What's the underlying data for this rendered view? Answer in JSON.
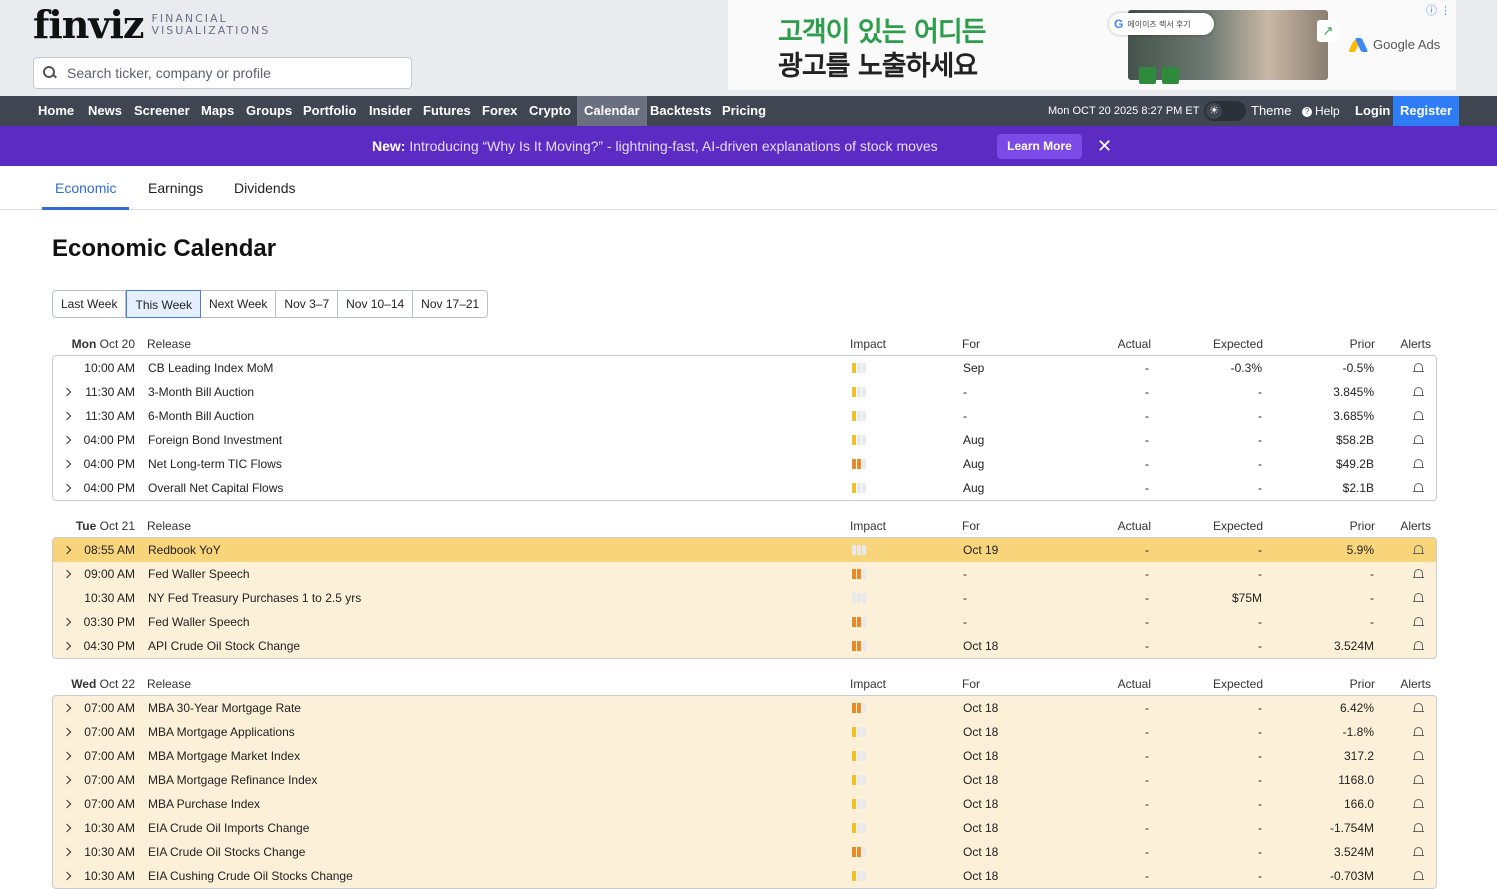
{
  "logo": {
    "word": "finviz",
    "sub1": "FINANCIAL",
    "sub2": "VISUALIZATIONS"
  },
  "search": {
    "placeholder": "Search ticker, company or profile"
  },
  "ad": {
    "line1": "고객이 있는 어디든",
    "line2": "광고를 노출하세요",
    "searchbar_text": "에이이즈 렉서 후기",
    "brand": "Google Ads",
    "info_icon": "info-icon"
  },
  "nav": {
    "items": [
      "Home",
      "News",
      "Screener",
      "Maps",
      "Groups",
      "Portfolio",
      "Insider",
      "Futures",
      "Forex",
      "Crypto",
      "Calendar",
      "Backtests",
      "Pricing"
    ],
    "active": "Calendar",
    "datetime": "Mon OCT 20 2025 8:27 PM ET",
    "theme": "Theme",
    "help": "Help",
    "login": "Login",
    "register": "Register"
  },
  "banner": {
    "new_label": "New:",
    "text": " Introducing “Why Is It Moving?” - lightning-fast, AI-driven explanations of stock moves",
    "button": "Learn More",
    "close_glyph": "✕"
  },
  "tabs": [
    "Economic",
    "Earnings",
    "Dividends"
  ],
  "page_title": "Economic Calendar",
  "weeks": [
    "Last Week",
    "This Week",
    "Next Week",
    "Nov 3–7",
    "Nov 10–14",
    "Nov 17–21"
  ],
  "active_week": "This Week",
  "columns": {
    "release": "Release",
    "impact": "Impact",
    "for": "For",
    "actual": "Actual",
    "expected": "Expected",
    "prior": "Prior",
    "alerts": "Alerts"
  },
  "impact_legend": {
    "low": "#f0c22a",
    "medium": "#e8892a",
    "empty": "#e7e9ee"
  },
  "days": [
    {
      "weekday": "Mon",
      "date": "Oct 20",
      "tinted": false,
      "rows": [
        {
          "time": "10:00 AM",
          "release": "CB Leading Index MoM",
          "impact": 1,
          "for": "Sep",
          "actual": "-",
          "expected": "-0.3%",
          "prior": "-0.5%",
          "expandable": false,
          "highlight": false
        },
        {
          "time": "11:30 AM",
          "release": "3-Month Bill Auction",
          "impact": 1,
          "for": "-",
          "actual": "-",
          "expected": "-",
          "prior": "3.845%",
          "expandable": true,
          "highlight": false
        },
        {
          "time": "11:30 AM",
          "release": "6-Month Bill Auction",
          "impact": 1,
          "for": "-",
          "actual": "-",
          "expected": "-",
          "prior": "3.685%",
          "expandable": true,
          "highlight": false
        },
        {
          "time": "04:00 PM",
          "release": "Foreign Bond Investment",
          "impact": 1,
          "for": "Aug",
          "actual": "-",
          "expected": "-",
          "prior": "$58.2B",
          "expandable": true,
          "highlight": false
        },
        {
          "time": "04:00 PM",
          "release": "Net Long-term TIC Flows",
          "impact": 2,
          "for": "Aug",
          "actual": "-",
          "expected": "-",
          "prior": "$49.2B",
          "expandable": true,
          "highlight": false
        },
        {
          "time": "04:00 PM",
          "release": "Overall Net Capital Flows",
          "impact": 1,
          "for": "Aug",
          "actual": "-",
          "expected": "-",
          "prior": "$2.1B",
          "expandable": true,
          "highlight": false
        }
      ]
    },
    {
      "weekday": "Tue",
      "date": "Oct 21",
      "tinted": true,
      "rows": [
        {
          "time": "08:55 AM",
          "release": "Redbook YoY",
          "impact": 0,
          "for": "Oct 19",
          "actual": "-",
          "expected": "-",
          "prior": "5.9%",
          "expandable": true,
          "highlight": true
        },
        {
          "time": "09:00 AM",
          "release": "Fed Waller Speech",
          "impact": 2,
          "for": "-",
          "actual": "-",
          "expected": "-",
          "prior": "-",
          "expandable": true,
          "highlight": false
        },
        {
          "time": "10:30 AM",
          "release": "NY Fed Treasury Purchases 1 to 2.5 yrs",
          "impact": 0,
          "for": "-",
          "actual": "-",
          "expected": "$75M",
          "prior": "-",
          "expandable": false,
          "highlight": false
        },
        {
          "time": "03:30 PM",
          "release": "Fed Waller Speech",
          "impact": 2,
          "for": "-",
          "actual": "-",
          "expected": "-",
          "prior": "-",
          "expandable": true,
          "highlight": false
        },
        {
          "time": "04:30 PM",
          "release": "API Crude Oil Stock Change",
          "impact": 2,
          "for": "Oct 18",
          "actual": "-",
          "expected": "-",
          "prior": "3.524M",
          "expandable": true,
          "highlight": false
        }
      ]
    },
    {
      "weekday": "Wed",
      "date": "Oct 22",
      "tinted": true,
      "rows": [
        {
          "time": "07:00 AM",
          "release": "MBA 30-Year Mortgage Rate",
          "impact": 2,
          "for": "Oct 18",
          "actual": "-",
          "expected": "-",
          "prior": "6.42%",
          "expandable": true,
          "highlight": false
        },
        {
          "time": "07:00 AM",
          "release": "MBA Mortgage Applications",
          "impact": 1,
          "for": "Oct 18",
          "actual": "-",
          "expected": "-",
          "prior": "-1.8%",
          "expandable": true,
          "highlight": false
        },
        {
          "time": "07:00 AM",
          "release": "MBA Mortgage Market Index",
          "impact": 1,
          "for": "Oct 18",
          "actual": "-",
          "expected": "-",
          "prior": "317.2",
          "expandable": true,
          "highlight": false
        },
        {
          "time": "07:00 AM",
          "release": "MBA Mortgage Refinance Index",
          "impact": 1,
          "for": "Oct 18",
          "actual": "-",
          "expected": "-",
          "prior": "1168.0",
          "expandable": true,
          "highlight": false
        },
        {
          "time": "07:00 AM",
          "release": "MBA Purchase Index",
          "impact": 1,
          "for": "Oct 18",
          "actual": "-",
          "expected": "-",
          "prior": "166.0",
          "expandable": true,
          "highlight": false
        },
        {
          "time": "10:30 AM",
          "release": "EIA Crude Oil Imports Change",
          "impact": 1,
          "for": "Oct 18",
          "actual": "-",
          "expected": "-",
          "prior": "-1.754M",
          "expandable": true,
          "highlight": false
        },
        {
          "time": "10:30 AM",
          "release": "EIA Crude Oil Stocks Change",
          "impact": 2,
          "for": "Oct 18",
          "actual": "-",
          "expected": "-",
          "prior": "3.524M",
          "expandable": true,
          "highlight": false
        },
        {
          "time": "10:30 AM",
          "release": "EIA Cushing Crude Oil Stocks Change",
          "impact": 1,
          "for": "Oct 18",
          "actual": "-",
          "expected": "-",
          "prior": "-0.703M",
          "expandable": true,
          "highlight": false
        }
      ]
    }
  ]
}
